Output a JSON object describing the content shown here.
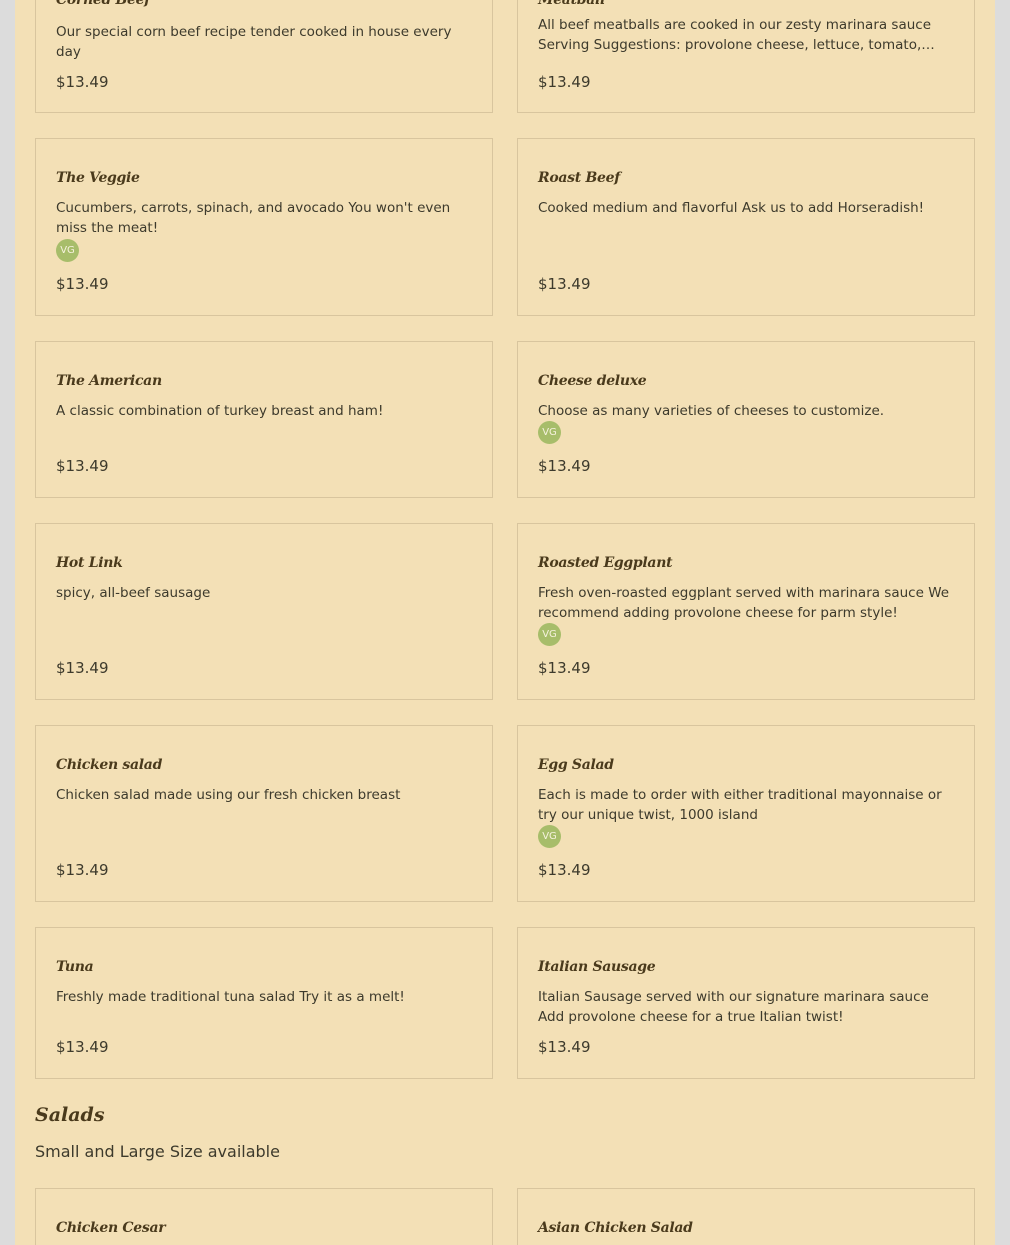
{
  "items": [
    {
      "name": "Corned Beef",
      "desc": "Our special corn beef recipe tender cooked in house every day",
      "price": "$13.49"
    },
    {
      "name": "Meatball",
      "desc": "All beef meatballs are cooked in our zesty marinara sauce Serving Suggestions: provolone cheese, lettuce, tomato, and...",
      "price": "$13.49"
    },
    {
      "name": "The Veggie",
      "desc": "Cucumbers, carrots, spinach, and avocado You won't even miss the meat!",
      "badge": "VG",
      "price": "$13.49"
    },
    {
      "name": "Roast Beef",
      "desc": "Cooked medium and flavorful Ask us to add Horseradish!",
      "price": "$13.49"
    },
    {
      "name": "The American",
      "desc": "A classic combination of turkey breast and ham!",
      "price": "$13.49"
    },
    {
      "name": "Cheese deluxe",
      "desc": "Choose as many varieties of cheeses to customize.",
      "badge": "VG",
      "price": "$13.49"
    },
    {
      "name": "Hot Link",
      "desc": "spicy, all-beef sausage",
      "price": "$13.49"
    },
    {
      "name": "Roasted Eggplant",
      "desc": "Fresh oven-roasted eggplant served with marinara sauce We recommend adding provolone cheese for parm style!",
      "badge": "VG",
      "price": "$13.49"
    },
    {
      "name": "Chicken salad",
      "desc": "Chicken salad made using our fresh chicken breast",
      "price": "$13.49"
    },
    {
      "name": "Egg Salad",
      "desc": "Each is made to order with either traditional mayonnaise or try our unique twist, 1000 island",
      "badge": "VG",
      "price": "$13.49"
    },
    {
      "name": "Tuna",
      "desc": "Freshly made traditional tuna salad Try it as a melt!",
      "price": "$13.49"
    },
    {
      "name": "Italian Sausage",
      "desc": "Italian Sausage served with our signature marinara sauce Add provolone cheese for a true Italian twist!",
      "price": "$13.49"
    }
  ],
  "section": {
    "title": "Salads",
    "subtitle": "Small and Large Size available"
  },
  "salads": [
    {
      "name": "Chicken Cesar"
    },
    {
      "name": "Asian Chicken Salad"
    }
  ],
  "colors": {
    "background": "#f3e0b6",
    "border": "#d8c59e",
    "vg_badge": "#a7bd6a"
  }
}
